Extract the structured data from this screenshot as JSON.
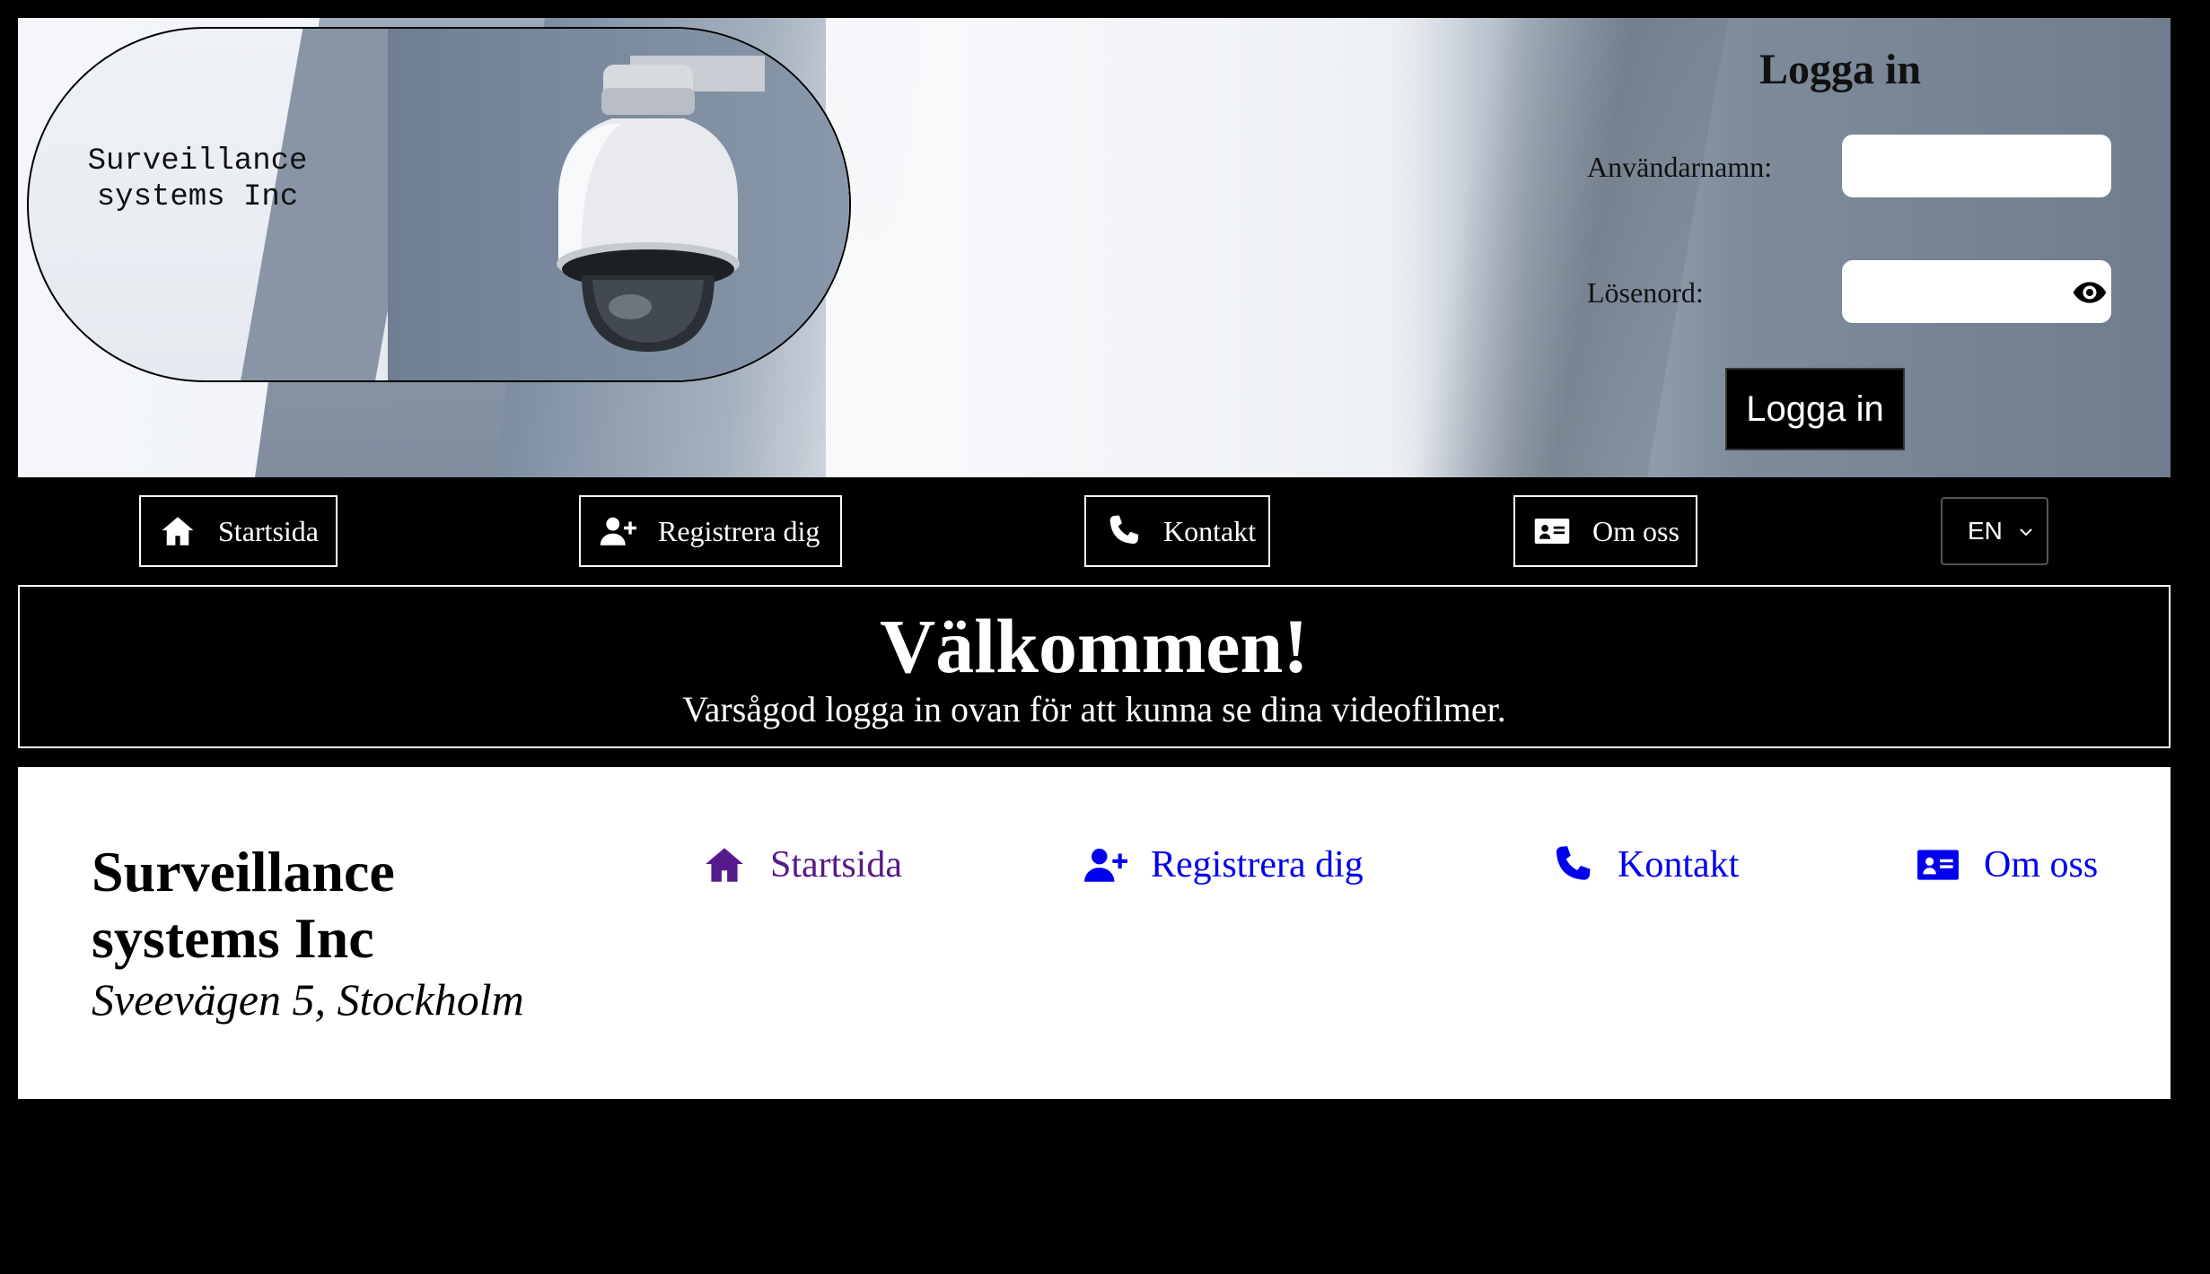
{
  "header": {
    "logo_text": "Surveillance systems Inc",
    "login": {
      "title": "Logga in",
      "username_label": "Användarnamn:",
      "username_value": "",
      "password_label": "Lösenord:",
      "password_value": "",
      "button_label": "Logga in",
      "password_toggle_icon": "eye-icon"
    }
  },
  "nav": {
    "items": [
      {
        "label": "Startsida",
        "icon": "home-icon"
      },
      {
        "label": "Registrera dig",
        "icon": "user-plus-icon"
      },
      {
        "label": "Kontakt",
        "icon": "phone-icon"
      },
      {
        "label": "Om oss",
        "icon": "id-card-icon"
      }
    ],
    "language": {
      "selected": "EN"
    }
  },
  "welcome": {
    "title": "Välkommen!",
    "subtitle": "Varsågod logga in ovan för att kunna se dina videofilmer."
  },
  "footer": {
    "company": "Surveillance systems Inc",
    "address": "Sveevägen 5, Stockholm",
    "links": [
      {
        "label": "Startsida",
        "icon": "home-icon",
        "visited": true
      },
      {
        "label": "Registrera dig",
        "icon": "user-plus-icon"
      },
      {
        "label": "Kontakt",
        "icon": "phone-icon"
      },
      {
        "label": "Om oss",
        "icon": "id-card-icon"
      }
    ]
  },
  "colors": {
    "background": "#000000",
    "link": "#0000ee",
    "visited_link": "#551a8b",
    "panel": "#ffffff"
  }
}
